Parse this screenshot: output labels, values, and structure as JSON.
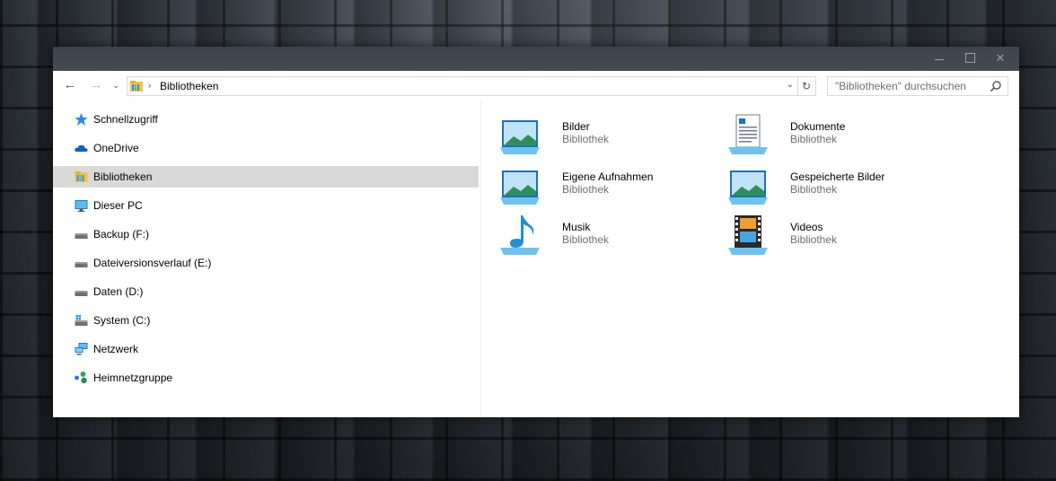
{
  "window": {
    "controls": {
      "minimize": "minimize",
      "maximize": "maximize",
      "close": "✕"
    }
  },
  "toolbar": {
    "back": "←",
    "forward": "→",
    "recent": "⌄",
    "breadcrumb_sep": "›",
    "breadcrumb": "Bibliotheken",
    "dropdown": "⌄",
    "refresh": "↻",
    "search_placeholder": "\"Bibliotheken\" durchsuchen"
  },
  "sidebar": {
    "items": [
      {
        "label": "Schnellzugriff",
        "icon": "star-icon"
      },
      {
        "label": "OneDrive",
        "icon": "cloud-icon"
      },
      {
        "label": "Bibliotheken",
        "icon": "library-icon",
        "selected": true
      },
      {
        "label": "Dieser PC",
        "icon": "monitor-icon"
      },
      {
        "label": "Backup (F:)",
        "icon": "drive-icon"
      },
      {
        "label": "Dateiversionsverlauf (E:)",
        "icon": "drive-icon"
      },
      {
        "label": "Daten (D:)",
        "icon": "drive-icon"
      },
      {
        "label": "System (C:)",
        "icon": "system-drive-icon"
      },
      {
        "label": "Netzwerk",
        "icon": "network-icon"
      },
      {
        "label": "Heimnetzgruppe",
        "icon": "homegroup-icon"
      }
    ]
  },
  "libraries": [
    {
      "name": "Bilder",
      "type": "Bibliothek",
      "icon": "pictures-library-icon"
    },
    {
      "name": "Dokumente",
      "type": "Bibliothek",
      "icon": "documents-library-icon"
    },
    {
      "name": "Eigene Aufnahmen",
      "type": "Bibliothek",
      "icon": "camera-roll-library-icon"
    },
    {
      "name": "Gespeicherte Bilder",
      "type": "Bibliothek",
      "icon": "saved-pictures-library-icon"
    },
    {
      "name": "Musik",
      "type": "Bibliothek",
      "icon": "music-library-icon"
    },
    {
      "name": "Videos",
      "type": "Bibliothek",
      "icon": "videos-library-icon"
    }
  ],
  "colors": {
    "selection": "#d9d9d9",
    "accent_blue": "#1e90d8",
    "secondary_text": "#6d6d6d"
  }
}
